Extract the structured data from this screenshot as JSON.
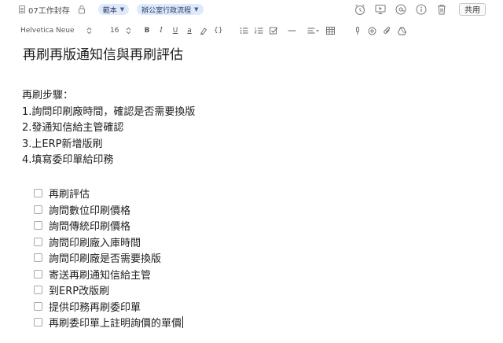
{
  "header": {
    "notebook": "07工作封存",
    "tags": [
      {
        "label": "範本"
      },
      {
        "label": "辦公室行政流程"
      }
    ],
    "share_label": "共用"
  },
  "toolbar": {
    "font_family": "Helvetica Neue",
    "font_size": "16",
    "bold": "B",
    "italic": "I",
    "underline": "U",
    "text_color": "a",
    "code": "{}"
  },
  "note": {
    "title": "再刷再版通知信與再刷評估",
    "steps": [
      "再刷步驟：",
      "1.詢問印刷廠時間，確認是否需要換版",
      "2.發通知信給主管確認",
      "3.上ERP新增版刷",
      "4.填寫委印單給印務"
    ],
    "checklist": [
      "再刷評估",
      "詢問數位印刷價格",
      "詢問傳統印刷價格",
      "詢問印刷廠入庫時間",
      "詢問印刷廠是否需要換版",
      "寄送再刷通知信給主管",
      "到ERP改版刷",
      "提供印務再刷委印單",
      "再刷委印單上註明詢價的單價"
    ]
  },
  "colors": {
    "tag_bg": "#dfe9f8",
    "tag_text": "#243b6b",
    "icon_gray": "#7a7a7a"
  }
}
